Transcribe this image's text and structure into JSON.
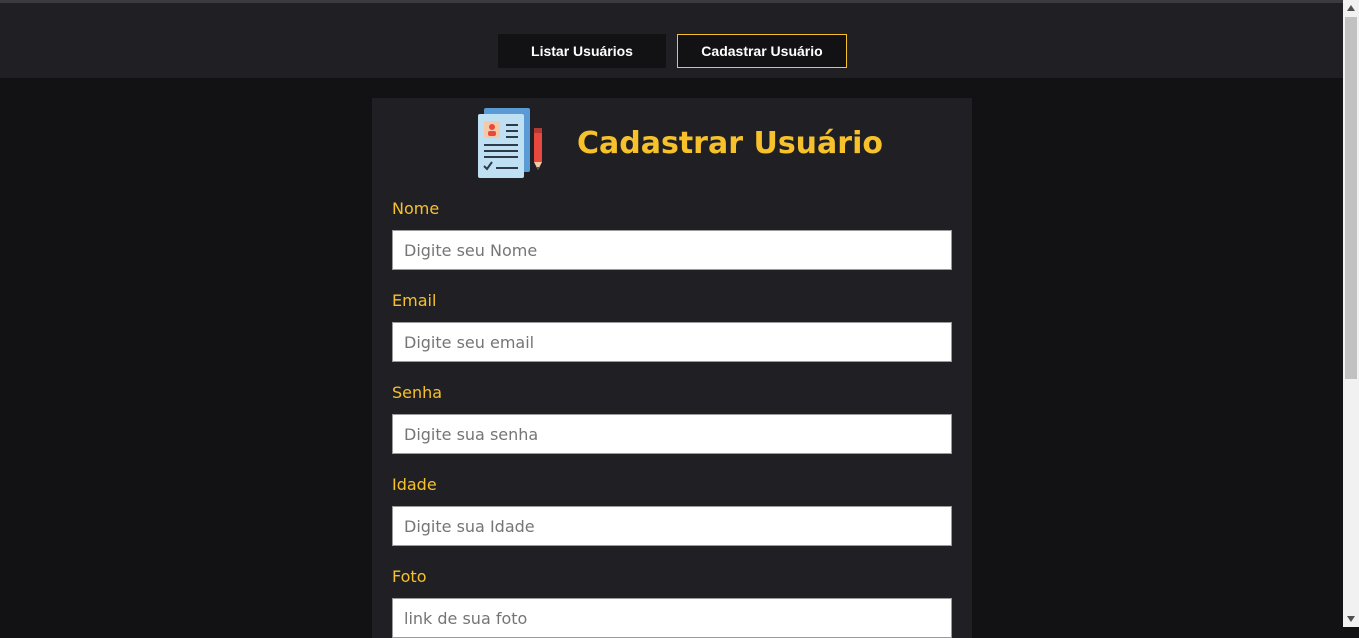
{
  "nav": {
    "list_label": "Listar Usuários",
    "create_label": "Cadastrar Usuário"
  },
  "form": {
    "title": "Cadastrar Usuário",
    "icon": "document-form-icon",
    "fields": [
      {
        "label": "Nome",
        "placeholder": "Digite seu Nome",
        "value": ""
      },
      {
        "label": "Email",
        "placeholder": "Digite seu email",
        "value": ""
      },
      {
        "label": "Senha",
        "placeholder": "Digite sua senha",
        "value": ""
      },
      {
        "label": "Idade",
        "placeholder": "Digite sua Idade",
        "value": ""
      },
      {
        "label": "Foto",
        "placeholder": "link de sua foto",
        "value": ""
      }
    ]
  },
  "colors": {
    "accent": "#f7c12b",
    "background": "#121214",
    "surface": "#202024"
  }
}
